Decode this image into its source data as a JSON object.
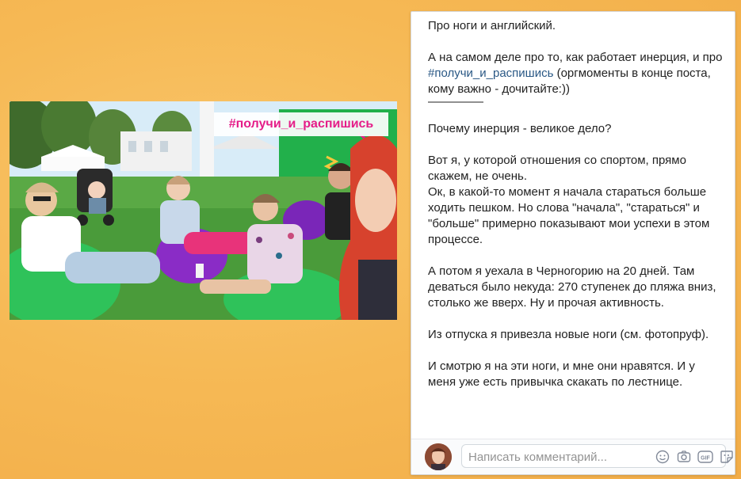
{
  "photo": {
    "hashtag_overlay": "#получи_и_распишись"
  },
  "post": {
    "lines": [
      "Про ноги и английский.",
      "А на самом деле про то, как работает инерция, и про",
      "#получи_и_распишись",
      "(оргмоменты в конце поста, кому важно - дочитайте:))",
      "Почему инерция - великое дело?",
      "Вот я, у которой отношения со спортом, прямо скажем, не очень.",
      "Ок, в какой-то момент я начала стараться больше ходить пешком. Но слова \"начала\", \"стараться\" и \"больше\" примерно показывают мои успехи в этом процессе.",
      "А потом я уехала в Черногорию на 20 дней. Там деваться было некуда: 270 ступенек до пляжа вниз, столько же вверх. Ну и прочая активность.",
      "Из отпуска я привезла новые ноги (см. фотопруф).",
      "И смотрю я на эти ноги, и мне они нравятся. И у меня уже есть привычка скакать по лестнице."
    ]
  },
  "comment": {
    "placeholder": "Написать комментарий...",
    "icons": [
      "smile-icon",
      "camera-icon",
      "gif-icon",
      "sticker-icon"
    ]
  },
  "colors": {
    "background": "#f6b955",
    "hashtag_overlay": "#e51e89",
    "link": "#2a5885"
  }
}
